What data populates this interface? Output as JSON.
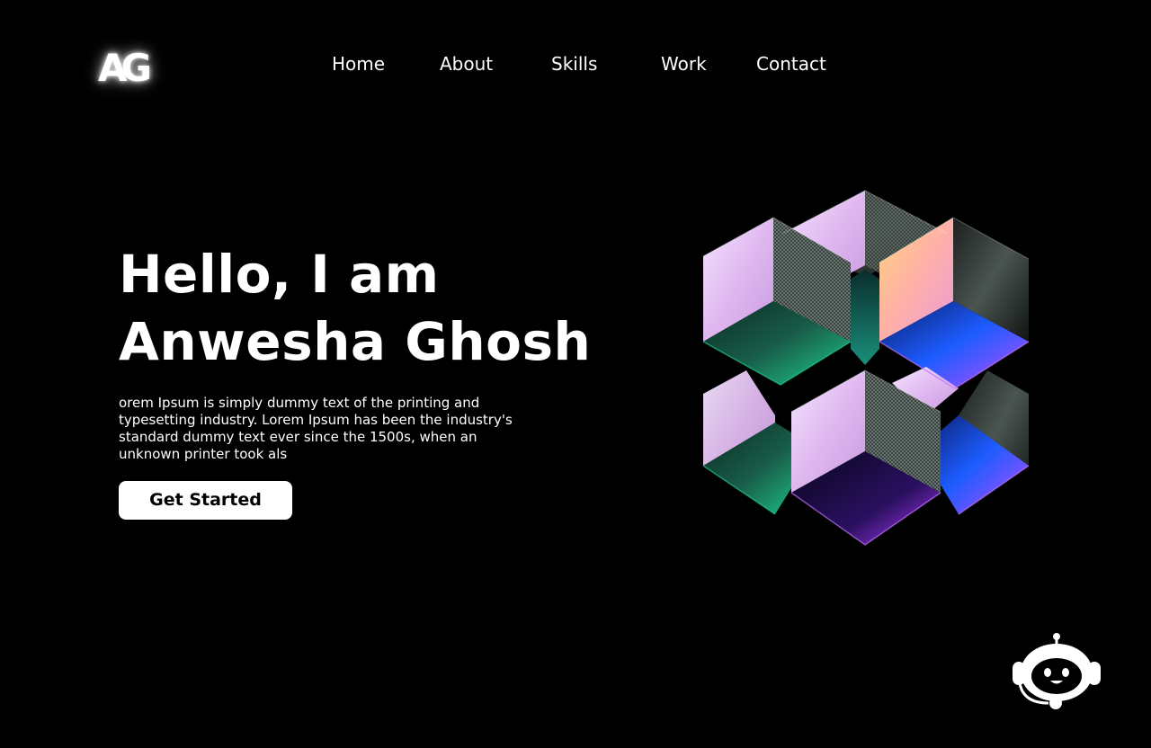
{
  "brand": {
    "logo_text": "AG"
  },
  "nav": {
    "items": [
      {
        "label": "Home"
      },
      {
        "label": "About"
      },
      {
        "label": "Skills"
      },
      {
        "label": "Work"
      },
      {
        "label": "Contact"
      }
    ]
  },
  "hero": {
    "title_line1": "Hello, I am",
    "title_line2": "Anwesha Ghosh",
    "description": "orem Ipsum is simply dummy text of the printing and typesetting industry. Lorem Ipsum has been the industry's standard dummy text ever since the 1500s, when an unknown printer took als",
    "cta_label": "Get Started"
  },
  "illustration": {
    "icon": "iridescent-cubes"
  },
  "chatbot": {
    "icon": "robot-headset-icon"
  },
  "colors": {
    "background": "#000000",
    "text": "#ffffff",
    "button_bg": "#ffffff",
    "button_text": "#000000"
  }
}
